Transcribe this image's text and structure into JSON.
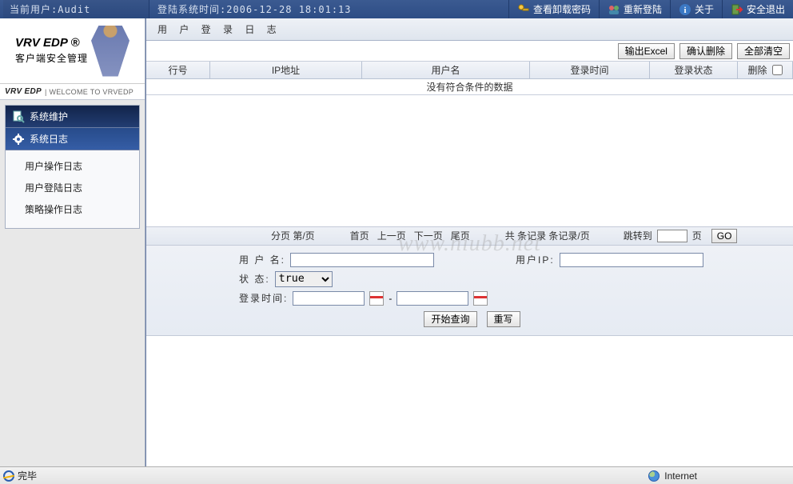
{
  "topbar": {
    "current_user_label": "当前用户:Audit",
    "login_time_label": "登陆系统时间:2006-12-28 18:01:13",
    "links": {
      "view_pwd": "查看卸载密码",
      "relogin": "重新登陆",
      "about": "关于",
      "exit": "安全退出"
    }
  },
  "sidebar": {
    "brand": "VRV EDP",
    "brand_reg": "®",
    "brand_sub": "客户端安全管理",
    "welcome_brand": "VRV EDP",
    "welcome_text": " | WELCOME TO VRVEDP",
    "group_maint": "系统维护",
    "group_log": "系统日志",
    "sub_user_op": "用户操作日志",
    "sub_user_login": "用户登陆日志",
    "sub_policy_op": "策略操作日志"
  },
  "page": {
    "title": "用 户 登 录 日 志",
    "btn_excel": "输出Excel",
    "btn_confirm_del": "确认删除",
    "btn_clear_all": "全部清空"
  },
  "grid": {
    "col_row": "行号",
    "col_ip": "IP地址",
    "col_user": "用户名",
    "col_time": "登录时间",
    "col_state": "登录状态",
    "col_del": "删除",
    "empty": "没有符合条件的数据"
  },
  "watermark": "www.niubb.net",
  "pager": {
    "page_label_a": "分页  第/页",
    "first": "首页",
    "prev": "上一页",
    "next": "下一页",
    "last": "尾页",
    "total": "共 条记录  条记录/页",
    "jump": "跳转到",
    "page_suffix": "页",
    "go": "GO"
  },
  "filter": {
    "username": "用 户 名:",
    "userip": "用户IP:",
    "state": "状    态:",
    "state_value": "true",
    "login_time": "登录时间:",
    "sep": "-",
    "btn_query": "开始查询",
    "btn_reset": "重写"
  },
  "status": {
    "done": "完毕",
    "zone": "Internet"
  }
}
